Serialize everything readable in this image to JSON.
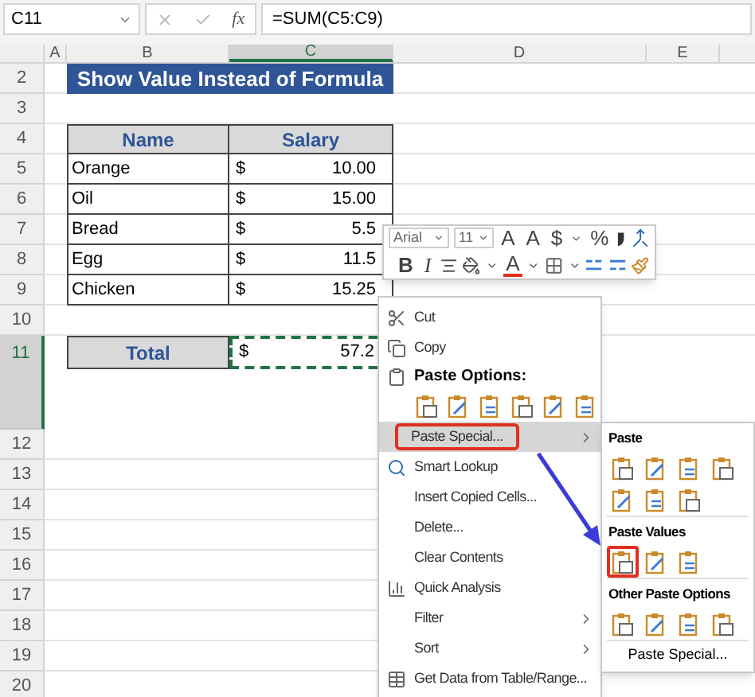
{
  "formula_bar": {
    "name_box": "C11",
    "function_label": "fx",
    "formula": "=SUM(C5:C9)"
  },
  "columns": [
    {
      "label": "A",
      "selected": false
    },
    {
      "label": "B",
      "selected": false
    },
    {
      "label": "C",
      "selected": true
    },
    {
      "label": "D",
      "selected": false
    },
    {
      "label": "E",
      "selected": false
    }
  ],
  "rows": [
    {
      "number": "2",
      "selected": false,
      "kind": "title",
      "text": "Show Value Instead of Formula"
    },
    {
      "number": "3",
      "selected": false,
      "kind": "blank"
    },
    {
      "number": "4",
      "selected": false,
      "kind": "header",
      "cells": [
        "Name",
        "Salary"
      ]
    },
    {
      "number": "5",
      "selected": false,
      "kind": "data",
      "name": "Orange",
      "currency": "$",
      "amount": "10.00"
    },
    {
      "number": "6",
      "selected": false,
      "kind": "data",
      "name": "Oil",
      "currency": "$",
      "amount": "15.00"
    },
    {
      "number": "7",
      "selected": false,
      "kind": "data",
      "name": "Bread",
      "currency": "$",
      "amount": "5.5"
    },
    {
      "number": "8",
      "selected": false,
      "kind": "data",
      "name": "Egg",
      "currency": "$",
      "amount": "11.5"
    },
    {
      "number": "9",
      "selected": false,
      "kind": "data",
      "name": "Chicken",
      "currency": "$",
      "amount": "15.25"
    },
    {
      "number": "10",
      "selected": false,
      "kind": "blank"
    },
    {
      "number": "11",
      "selected": true,
      "kind": "total",
      "label": "Total",
      "currency": "$",
      "amount": "57.2",
      "copied": true
    },
    {
      "number": "12",
      "selected": false,
      "kind": "blank"
    },
    {
      "number": "13",
      "selected": false,
      "kind": "blank"
    },
    {
      "number": "14",
      "selected": false,
      "kind": "blank"
    },
    {
      "number": "15",
      "selected": false,
      "kind": "blank"
    },
    {
      "number": "16",
      "selected": false,
      "kind": "blank"
    },
    {
      "number": "17",
      "selected": false,
      "kind": "blank"
    },
    {
      "number": "18",
      "selected": false,
      "kind": "blank"
    },
    {
      "number": "19",
      "selected": false,
      "kind": "blank"
    },
    {
      "number": "20",
      "selected": false,
      "kind": "blank"
    }
  ],
  "mini_toolbar": {
    "font": "Arial",
    "size": "11",
    "row1": [
      {
        "kind": "grow",
        "label": "A"
      },
      {
        "kind": "shrink",
        "label": "A"
      },
      {
        "kind": "currency",
        "label": "$"
      },
      {
        "kind": "caret"
      },
      {
        "kind": "percent",
        "label": "%"
      },
      {
        "kind": "comma"
      },
      {
        "kind": "merge"
      }
    ],
    "row2": [
      {
        "kind": "bold",
        "label": "B"
      },
      {
        "kind": "italic",
        "label": "I"
      },
      {
        "kind": "align"
      },
      {
        "kind": "fill"
      },
      {
        "kind": "caret"
      },
      {
        "kind": "fontcolor",
        "label": "A"
      },
      {
        "kind": "caret"
      },
      {
        "kind": "borders"
      },
      {
        "kind": "caret"
      },
      {
        "kind": "decdown"
      },
      {
        "kind": "decup"
      },
      {
        "kind": "painter"
      }
    ]
  },
  "context_menu": {
    "items": [
      {
        "kind": "command",
        "label": "Cut",
        "highlighted": false,
        "submenu": false,
        "callout": false
      },
      {
        "kind": "command",
        "label": "Copy",
        "highlighted": false,
        "submenu": false,
        "callout": false
      },
      {
        "kind": "heading",
        "label": "Paste Options:"
      },
      {
        "kind": "icons",
        "icons": [
          {
            "highlighted": false
          },
          {
            "highlighted": false
          },
          {
            "highlighted": false
          },
          {
            "highlighted": false
          },
          {
            "highlighted": false
          },
          {
            "highlighted": false
          }
        ]
      },
      {
        "kind": "command",
        "label": "Paste Special...",
        "highlighted": true,
        "submenu": true,
        "callout": true
      },
      {
        "kind": "command",
        "label": "Smart Lookup",
        "highlighted": false,
        "submenu": false,
        "callout": false
      },
      {
        "kind": "command",
        "label": "Insert Copied Cells...",
        "highlighted": false,
        "submenu": false,
        "callout": false
      },
      {
        "kind": "command",
        "label": "Delete...",
        "highlighted": false,
        "submenu": false,
        "callout": false
      },
      {
        "kind": "command",
        "label": "Clear Contents",
        "highlighted": false,
        "submenu": false,
        "callout": false
      },
      {
        "kind": "command",
        "label": "Quick Analysis",
        "highlighted": false,
        "submenu": false,
        "callout": false
      },
      {
        "kind": "command",
        "label": "Filter",
        "highlighted": false,
        "submenu": true,
        "callout": false
      },
      {
        "kind": "command",
        "label": "Sort",
        "highlighted": false,
        "submenu": true,
        "callout": false
      },
      {
        "kind": "command",
        "label": "Get Data from Table/Range...",
        "highlighted": false,
        "submenu": false,
        "callout": false
      }
    ]
  },
  "submenu": {
    "sections": [
      {
        "heading": "Paste",
        "icon_rows": [
          [
            {
              "highlighted": false
            },
            {
              "highlighted": false
            },
            {
              "highlighted": false
            },
            {
              "highlighted": false
            }
          ],
          [
            {
              "highlighted": false
            },
            {
              "highlighted": false
            },
            {
              "highlighted": false
            }
          ]
        ]
      },
      {
        "heading": "Paste Values",
        "icon_rows": [
          [
            {
              "highlighted": true
            },
            {
              "highlighted": false
            },
            {
              "highlighted": false
            }
          ]
        ]
      },
      {
        "heading": "Other Paste Options",
        "icon_rows": [
          [
            {
              "highlighted": false
            },
            {
              "highlighted": false
            },
            {
              "highlighted": false
            },
            {
              "highlighted": false
            }
          ]
        ]
      }
    ],
    "footer": "Paste Special..."
  }
}
